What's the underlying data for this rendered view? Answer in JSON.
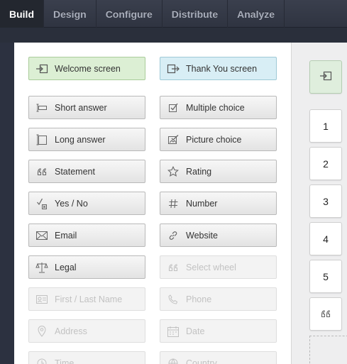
{
  "tabs": [
    {
      "label": "Build"
    },
    {
      "label": "Design"
    },
    {
      "label": "Configure"
    },
    {
      "label": "Distribute"
    },
    {
      "label": "Analyze"
    }
  ],
  "palette": {
    "welcome": {
      "label": "Welcome screen",
      "icon": "enter-icon"
    },
    "thankyou": {
      "label": "Thank You screen",
      "icon": "exit-icon"
    },
    "fields": [
      {
        "label": "Short answer",
        "icon": "short-answer-icon",
        "enabled": true
      },
      {
        "label": "Multiple choice",
        "icon": "checkbox-icon",
        "enabled": true
      },
      {
        "label": "Long answer",
        "icon": "long-answer-icon",
        "enabled": true
      },
      {
        "label": "Picture choice",
        "icon": "picture-check-icon",
        "enabled": true
      },
      {
        "label": "Statement",
        "icon": "quote-icon",
        "enabled": true
      },
      {
        "label": "Rating",
        "icon": "star-icon",
        "enabled": true
      },
      {
        "label": "Yes / No",
        "icon": "yes-no-icon",
        "enabled": true
      },
      {
        "label": "Number",
        "icon": "hash-icon",
        "enabled": true
      },
      {
        "label": "Email",
        "icon": "envelope-icon",
        "enabled": true
      },
      {
        "label": "Website",
        "icon": "link-icon",
        "enabled": true
      },
      {
        "label": "Legal",
        "icon": "scales-icon",
        "enabled": true
      },
      {
        "label": "Select wheel",
        "icon": "quote-icon",
        "enabled": false
      },
      {
        "label": "First / Last Name",
        "icon": "id-card-icon",
        "enabled": false
      },
      {
        "label": "Phone",
        "icon": "phone-icon",
        "enabled": false
      },
      {
        "label": "Address",
        "icon": "map-pin-icon",
        "enabled": false
      },
      {
        "label": "Date",
        "icon": "calendar-icon",
        "enabled": false
      },
      {
        "label": "Time",
        "icon": "clock-icon",
        "enabled": false
      },
      {
        "label": "Country",
        "icon": "globe-icon",
        "enabled": false
      }
    ]
  },
  "sequence": {
    "welcome_icon": "enter-icon",
    "items": [
      "1",
      "2",
      "3",
      "4",
      "5"
    ],
    "statement_icon": "quote-icon"
  },
  "colors": {
    "nav_bg": "#2f3441",
    "welcome_green": "#dcefd4",
    "thankyou_blue": "#d8eef5"
  }
}
